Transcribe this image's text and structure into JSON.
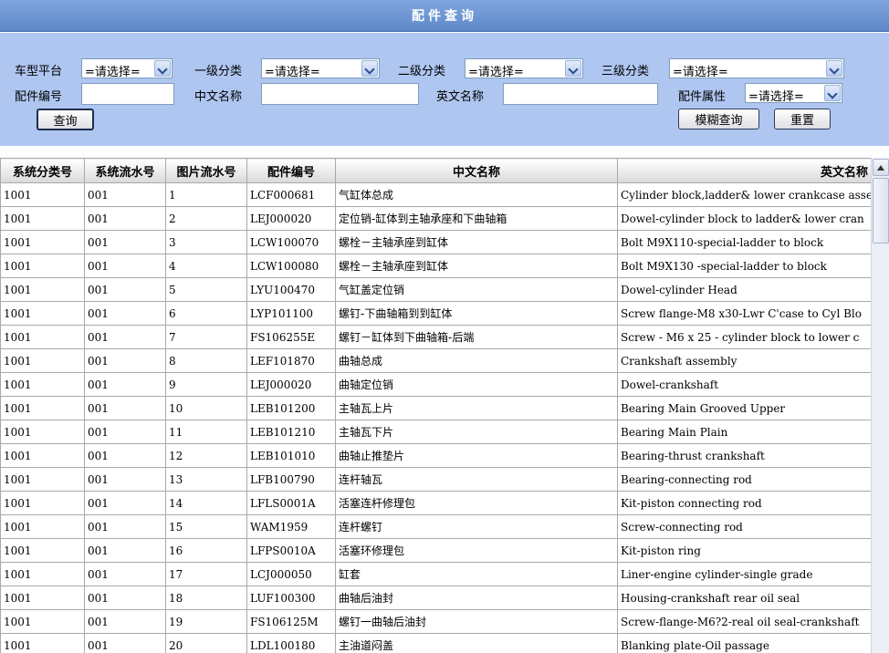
{
  "header": {
    "title": "配件查询"
  },
  "filters": {
    "vehicle_platform": {
      "label": "车型平台",
      "value": "=请选择="
    },
    "category_1": {
      "label": "一级分类",
      "value": "=请选择="
    },
    "category_2": {
      "label": "二级分类",
      "value": "=请选择="
    },
    "category_3": {
      "label": "三级分类",
      "value": "=请选择="
    },
    "part_number": {
      "label": "配件编号",
      "value": ""
    },
    "chinese_name": {
      "label": "中文名称",
      "value": ""
    },
    "english_name": {
      "label": "英文名称",
      "value": ""
    },
    "part_attribute": {
      "label": "配件属性",
      "value": "=请选择="
    }
  },
  "buttons": {
    "query": "查询",
    "fuzzy_query": "模糊查询",
    "reset": "重置"
  },
  "table": {
    "columns": [
      "系统分类号",
      "系统流水号",
      "图片流水号",
      "配件编号",
      "中文名称",
      "英文名称"
    ],
    "rows": [
      [
        "1001",
        "001",
        "1",
        "LCF000681",
        "气缸体总成",
        "Cylinder block,ladder& lower crankcase asse"
      ],
      [
        "1001",
        "001",
        "2",
        "LEJ000020",
        "定位销-缸体到主轴承座和下曲轴箱",
        "Dowel-cylinder block to ladder& lower cran"
      ],
      [
        "1001",
        "001",
        "3",
        "LCW100070",
        "螺栓－主轴承座到缸体",
        "Bolt M9X110-special-ladder to block"
      ],
      [
        "1001",
        "001",
        "4",
        "LCW100080",
        "螺栓－主轴承座到缸体",
        "Bolt M9X130 -special-ladder to block"
      ],
      [
        "1001",
        "001",
        "5",
        "LYU100470",
        "气缸盖定位销",
        "Dowel-cylinder Head"
      ],
      [
        "1001",
        "001",
        "6",
        "LYP101100",
        "螺钉-下曲轴箱到到缸体",
        "Screw flange-M8 x30-Lwr C'case to Cyl Blo"
      ],
      [
        "1001",
        "001",
        "7",
        "FS106255E",
        "螺钉－缸体到下曲轴箱-后端",
        "Screw - M6 x 25 - cylinder block to lower c"
      ],
      [
        "1001",
        "001",
        "8",
        "LEF101870",
        "曲轴总成",
        "Crankshaft assembly"
      ],
      [
        "1001",
        "001",
        "9",
        "LEJ000020",
        "曲轴定位销",
        "Dowel-crankshaft"
      ],
      [
        "1001",
        "001",
        "10",
        "LEB101200",
        "主轴瓦上片",
        "Bearing Main Grooved Upper"
      ],
      [
        "1001",
        "001",
        "11",
        "LEB101210",
        "主轴瓦下片",
        "Bearing Main Plain"
      ],
      [
        "1001",
        "001",
        "12",
        "LEB101010",
        "曲轴止推垫片",
        "Bearing-thrust crankshaft"
      ],
      [
        "1001",
        "001",
        "13",
        "LFB100790",
        "连杆轴瓦",
        "Bearing-connecting rod"
      ],
      [
        "1001",
        "001",
        "14",
        "LFLS0001A",
        "活塞连杆修理包",
        "Kit-piston connecting rod"
      ],
      [
        "1001",
        "001",
        "15",
        "WAM1959",
        "连杆螺钉",
        "Screw-connecting rod"
      ],
      [
        "1001",
        "001",
        "16",
        "LFPS0010A",
        "活塞环修理包",
        "Kit-piston ring"
      ],
      [
        "1001",
        "001",
        "17",
        "LCJ000050",
        "缸套",
        "Liner-engine cylinder-single grade"
      ],
      [
        "1001",
        "001",
        "18",
        "LUF100300",
        "曲轴后油封",
        "Housing-crankshaft rear oil seal"
      ],
      [
        "1001",
        "001",
        "19",
        "FS106125M",
        "螺钉一曲轴后油封",
        "Screw-flange-M6?2-real oil seal-crankshaft"
      ],
      [
        "1001",
        "001",
        "20",
        "LDL100180",
        "主油道闷盖",
        "Blanking plate-Oil passage"
      ]
    ]
  }
}
